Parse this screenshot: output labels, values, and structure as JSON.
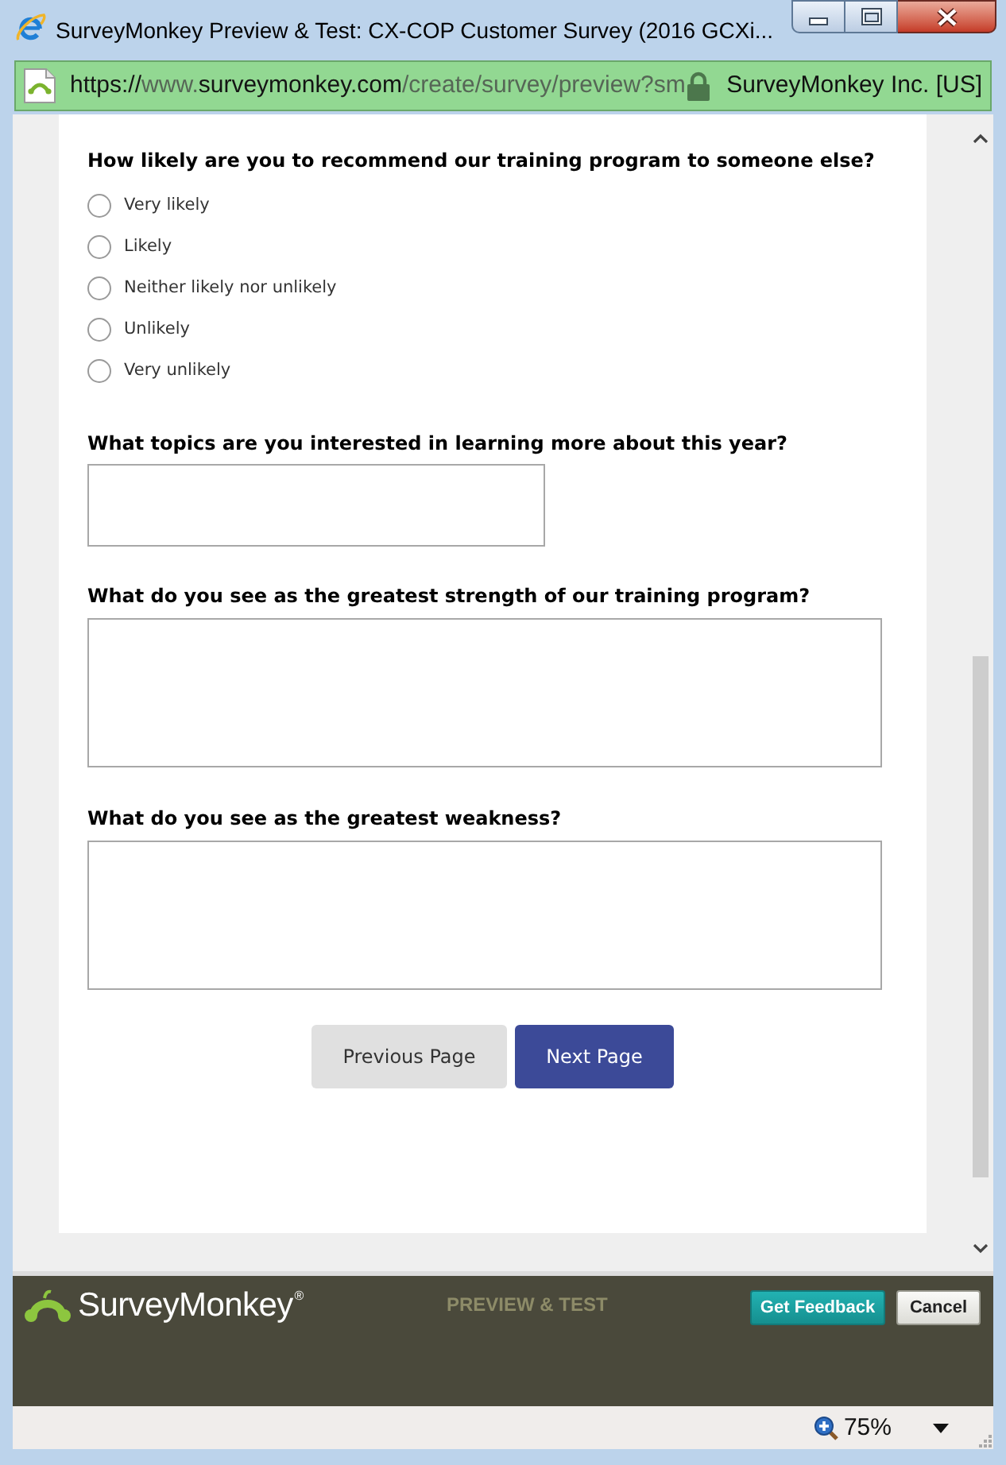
{
  "window": {
    "title": "SurveyMonkey Preview & Test: CX-COP Customer Survey (2016 GCXi..."
  },
  "address_bar": {
    "url": [
      {
        "text": "https://",
        "kind": "domain"
      },
      {
        "text": "www.",
        "kind": "path"
      },
      {
        "text": "surveymonkey.com",
        "kind": "domain"
      },
      {
        "text": "/create/survey/preview?sm",
        "kind": "path"
      }
    ],
    "site_identity": "SurveyMonkey Inc. [US]"
  },
  "survey": {
    "questions": [
      {
        "kind": "radio",
        "text": "How likely are you to recommend our training program to someone else?",
        "options": [
          {
            "label": "Very likely",
            "selected": false
          },
          {
            "label": "Likely",
            "selected": false
          },
          {
            "label": "Neither likely nor unlikely",
            "selected": false
          },
          {
            "label": "Unlikely",
            "selected": false
          },
          {
            "label": "Very unlikely",
            "selected": false
          }
        ]
      },
      {
        "kind": "single_line",
        "text": "What topics are you interested in learning more about this year?"
      },
      {
        "kind": "essay",
        "text": "What do you see as the greatest strength of our training program?"
      },
      {
        "kind": "essay",
        "text": "What do you see as the greatest weakness?"
      }
    ],
    "buttons": [
      {
        "label": "Previous Page",
        "kind": "secondary"
      },
      {
        "label": "Next Page",
        "kind": "primary"
      }
    ]
  },
  "footer": {
    "logo": "SurveyMonkey$^{®}$",
    "mode_label": "PREVIEW & TEST",
    "buttons": [
      {
        "label": "Get Feedback",
        "kind": "primary"
      },
      {
        "label": "Cancel",
        "kind": "secondary"
      }
    ]
  },
  "status_bar": {
    "zoom": "75%"
  }
}
